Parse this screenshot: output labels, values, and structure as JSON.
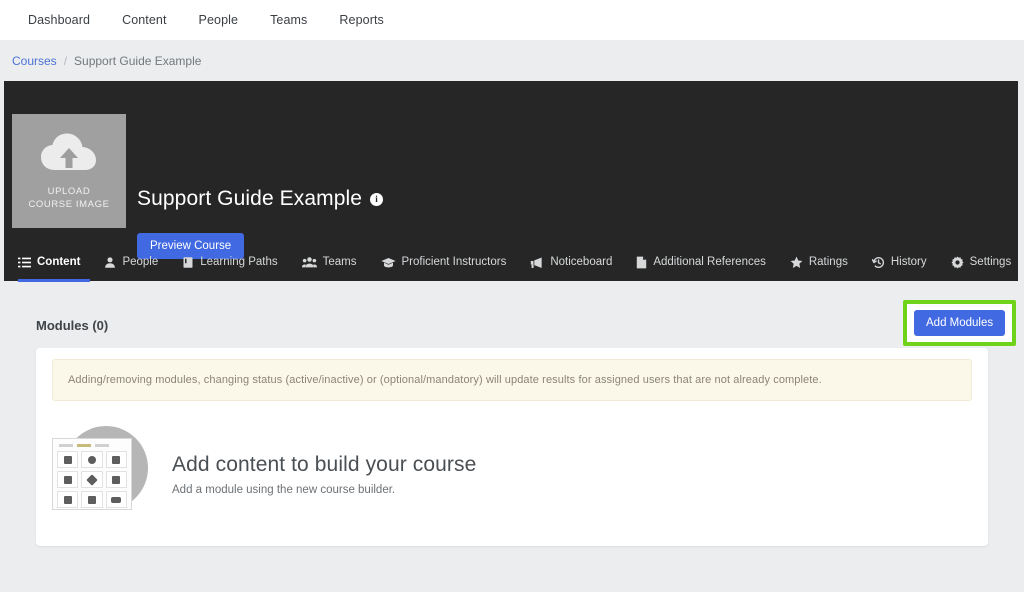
{
  "topnav": {
    "items": [
      {
        "label": "Dashboard"
      },
      {
        "label": "Content"
      },
      {
        "label": "People"
      },
      {
        "label": "Teams"
      },
      {
        "label": "Reports"
      }
    ]
  },
  "breadcrumb": {
    "root": "Courses",
    "separator": "/",
    "current": "Support Guide Example"
  },
  "hero": {
    "thumbnail": {
      "icon": "cloud-upload-icon",
      "line1": "UPLOAD",
      "line2": "COURSE IMAGE"
    },
    "title": "Support Guide Example",
    "info_icon": "info-icon",
    "info_glyph": "i",
    "preview_button": "Preview Course",
    "background": "#262626",
    "accent": "#4169e1"
  },
  "tabs": [
    {
      "label": "Content",
      "icon": "list-icon",
      "active": true
    },
    {
      "label": "People",
      "icon": "user-icon",
      "active": false
    },
    {
      "label": "Learning Paths",
      "icon": "book-icon",
      "active": false
    },
    {
      "label": "Teams",
      "icon": "users-icon",
      "active": false
    },
    {
      "label": "Proficient Instructors",
      "icon": "graduation-cap-icon",
      "active": false
    },
    {
      "label": "Noticeboard",
      "icon": "megaphone-icon",
      "active": false
    },
    {
      "label": "Additional References",
      "icon": "file-icon",
      "active": false
    },
    {
      "label": "Ratings",
      "icon": "star-icon",
      "active": false
    },
    {
      "label": "History",
      "icon": "history-clock-icon",
      "active": false
    },
    {
      "label": "Settings",
      "icon": "gear-icon",
      "active": false
    }
  ],
  "main": {
    "modules_heading": "Modules (0)",
    "add_modules_button": "Add Modules",
    "highlight_color": "#6fd419",
    "notice": "Adding/removing modules, changing status (active/inactive) or (optional/mandatory) will update results for assigned users that are not already complete.",
    "empty_state": {
      "illustration": "course-builder-grid-illustration",
      "title": "Add content to build your course",
      "subtitle": "Add a module using the new course builder."
    }
  }
}
